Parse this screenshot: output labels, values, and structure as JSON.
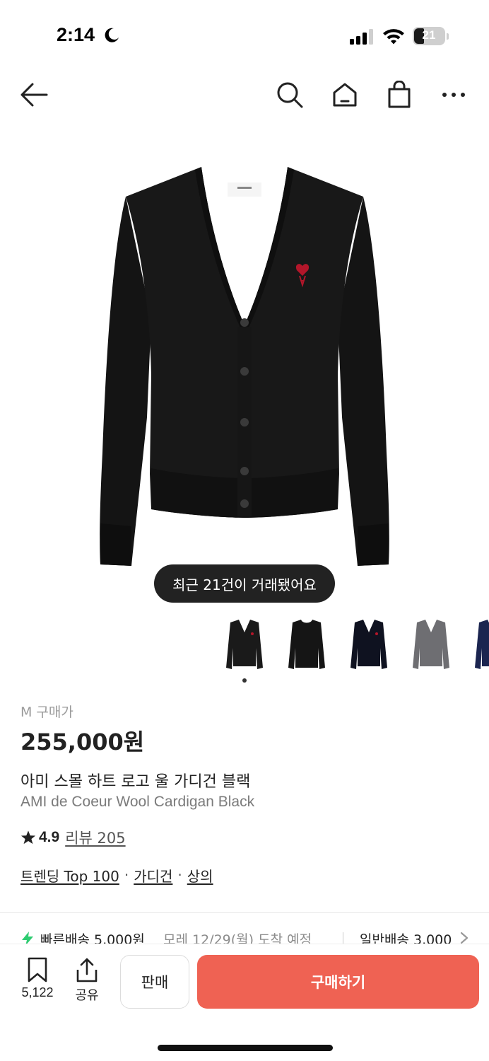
{
  "status_bar": {
    "time": "2:14",
    "battery": "21"
  },
  "nav": {
    "back": "arrow-left-icon",
    "search": "search-icon",
    "home": "home-icon",
    "bag": "shopping-bag-icon",
    "more": "more-icon"
  },
  "product": {
    "toast": "최근 21건이 거래됐어요",
    "size_label": "M 구매가",
    "price": "255,000원",
    "name_ko": "아미 스몰 하트 로고 울 가디건 블랙",
    "name_en": "AMI de Coeur Wool Cardigan Black",
    "rating": "4.9",
    "review_link": "리뷰 205",
    "tags": [
      "트렌딩 Top 100",
      "가디건",
      "상의"
    ],
    "tag_sep": "·"
  },
  "shipping": {
    "fast": "빠른배송 5,000원",
    "fast_date": "모레 12/29(월) 도착 예정",
    "normal": "일반배송 3,000"
  },
  "bottom_bar": {
    "bookmark_count": "5,122",
    "share_label": "공유",
    "sell_label": "판매",
    "buy_label": "구매하기"
  },
  "colors": {
    "accent": "#ef6253",
    "fast_ship": "#2ecc71",
    "toast_bg": "#222222"
  }
}
